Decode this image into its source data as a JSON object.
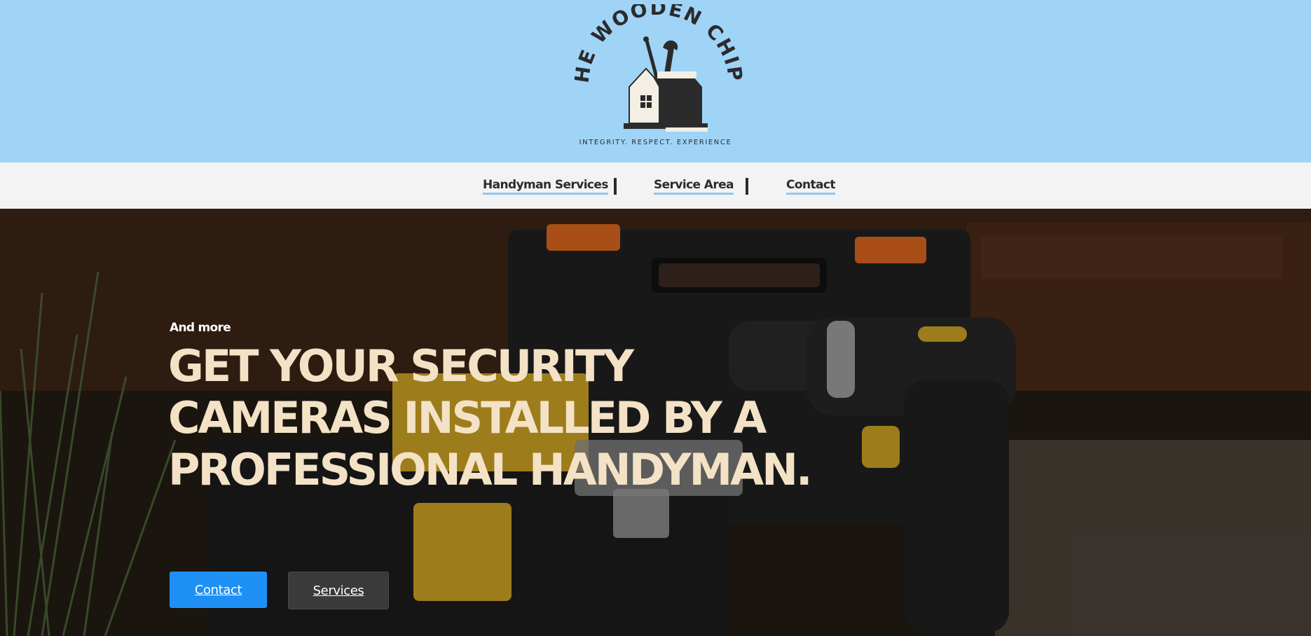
{
  "brand": {
    "logo_text": "THE WOODEN CHIPS",
    "tagline": "INTEGRITY. RESPECT. EXPERIENCE"
  },
  "nav": {
    "items": [
      {
        "label": "Handyman Services"
      },
      {
        "label": "Service Area"
      },
      {
        "label": "Contact"
      }
    ]
  },
  "hero": {
    "eyebrow": "And more",
    "headline": "GET YOUR SECURITY CAMERAS INSTALLED BY A PROFESSIONAL HANDYMAN.",
    "buttons": {
      "contact": "Contact",
      "services": "Services"
    }
  },
  "colors": {
    "header_bg": "#9fd4f7",
    "nav_bg": "#f3f3f3",
    "nav_underline": "#8fc9f0",
    "headline": "#f4e2c6",
    "primary_button": "#1e90f5",
    "secondary_button": "#3a3a3a"
  }
}
